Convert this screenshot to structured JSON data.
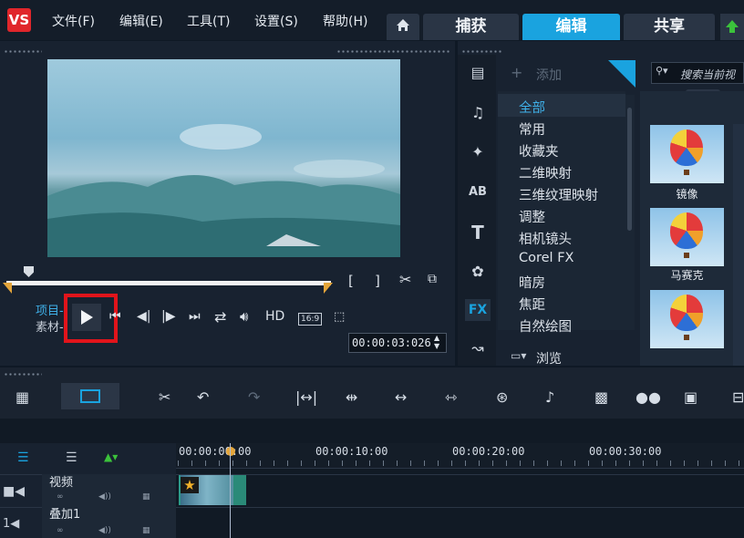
{
  "menu": {
    "file": "文件(F)",
    "edit": "编辑(E)",
    "tools": "工具(T)",
    "settings": "设置(S)",
    "help": "帮助(H)"
  },
  "tabs": {
    "capture": "捕获",
    "edit": "编辑",
    "share": "共享"
  },
  "player": {
    "project_label": "项目-",
    "clip_label": "素材-",
    "hd_label": "HD",
    "ratio_label": "16:9",
    "timecode": "00:00:03:026"
  },
  "library": {
    "add_label": "添加",
    "search_placeholder": "搜索当前视",
    "categories": [
      "全部",
      "常用",
      "收藏夹",
      "二维映射",
      "三维纹理映射",
      "调整",
      "相机镜头",
      "Corel FX",
      "暗房",
      "焦距",
      "自然绘图"
    ],
    "browse_label": "浏览",
    "fx_label": "FX",
    "thumbs": [
      {
        "caption": "镜像"
      },
      {
        "caption": "马赛克"
      },
      {
        "caption": ""
      }
    ]
  },
  "ruler": [
    "00:00:00:00",
    "00:00:10:00",
    "00:00:20:00",
    "00:00:30:00"
  ],
  "tracks": {
    "video": "视频",
    "overlay": "叠加1"
  },
  "colors": {
    "accent": "#1aa3df",
    "highlight": "#e1141b",
    "trim": "#e4a53a"
  }
}
